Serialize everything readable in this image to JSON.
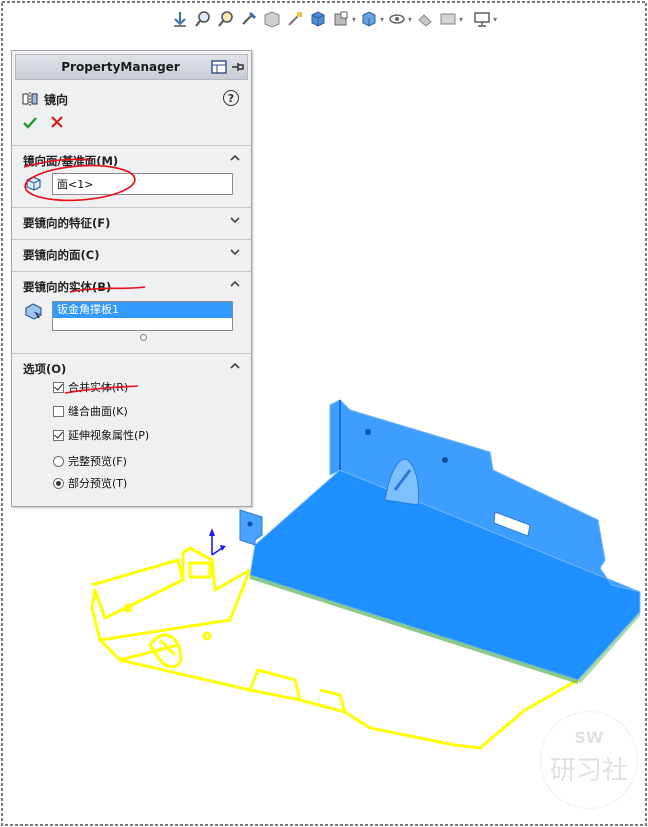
{
  "toolbar": {
    "icons": [
      "view-orientation-icon",
      "zoom-to-fit-icon",
      "zoom-to-area-icon",
      "previous-view-icon",
      "section-view-icon",
      "dynamic-annotation-icon",
      "view-orientation-cube-icon",
      "display-style-icon",
      "hide-show-items-icon",
      "edit-appearance-icon",
      "apply-scene-icon",
      "view-settings-icon",
      "monitor-icon"
    ]
  },
  "property_manager": {
    "title": "PropertyManager",
    "feature_name": "镜向",
    "help": "?",
    "mirror_face": {
      "title": "镜向面/基准面(M)",
      "value": "面<1>"
    },
    "features_to_mirror": {
      "title": "要镜向的特征(F)"
    },
    "faces_to_mirror": {
      "title": "要镜向的面(C)"
    },
    "bodies_to_mirror": {
      "title": "要镜向的实体(B)",
      "items": [
        "钣金角撑板1"
      ]
    },
    "options": {
      "title": "选项(O)",
      "merge_solids": {
        "label": "合并实体(R)",
        "checked": true
      },
      "knit_surfaces": {
        "label": "缝合曲面(K)",
        "checked": false
      },
      "propagate_visual": {
        "label": "延伸视象属性(P)",
        "checked": true
      },
      "full_preview": {
        "label": "完整预览(F)",
        "selected": false
      },
      "partial_preview": {
        "label": "部分预览(T)",
        "selected": true
      }
    }
  },
  "watermark": {
    "logo_text": "SW",
    "chars": "研习社"
  },
  "colors": {
    "accent": "#3399ff",
    "model_blue": "#1e90ff",
    "preview_yellow": "#ffff00",
    "annotation_red": "#e8101a"
  }
}
